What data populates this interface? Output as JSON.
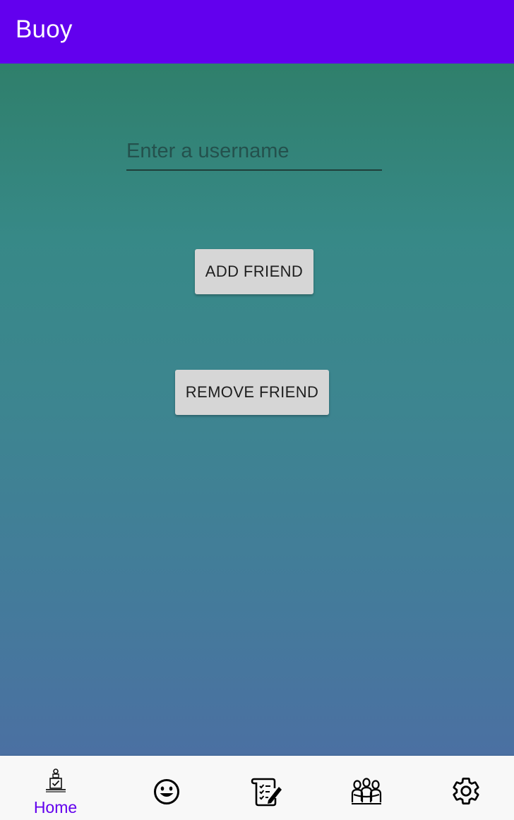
{
  "app_bar": {
    "title": "Buoy"
  },
  "form": {
    "username_placeholder": "Enter a username",
    "username_value": "",
    "add_friend_label": "ADD FRIEND",
    "remove_friend_label": "REMOVE FRIEND"
  },
  "bottom_nav": {
    "items": [
      {
        "icon": "home-checklist-icon",
        "label": "Home",
        "selected": true
      },
      {
        "icon": "smiley-face-icon",
        "label": "",
        "selected": false
      },
      {
        "icon": "journal-pencil-icon",
        "label": "",
        "selected": false
      },
      {
        "icon": "friends-group-icon",
        "label": "",
        "selected": false
      },
      {
        "icon": "gear-icon",
        "label": "",
        "selected": false
      }
    ]
  },
  "colors": {
    "app_bar": "#6200EE",
    "selected_nav": "#6200EE",
    "gradient_top": "#2F7F6B",
    "gradient_bottom": "#4B70A2",
    "button_bg": "#D6D6D6"
  }
}
